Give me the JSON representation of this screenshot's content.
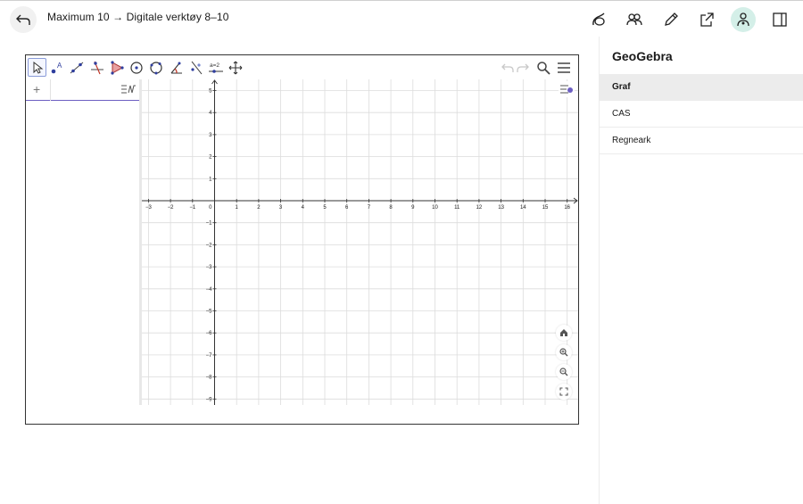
{
  "header": {
    "breadcrumb": "Maximum 10 → Digitale verktøy 8–10",
    "icons": [
      "back-arrow-icon",
      "geogebra-icon",
      "people-icon",
      "pencil-icon",
      "share-icon",
      "user-settings-icon",
      "sidebar-toggle-icon"
    ],
    "active_color": "#d4efe8"
  },
  "panel": {
    "title": "GeoGebra",
    "items": [
      {
        "label": "Graf",
        "active": true
      },
      {
        "label": "CAS",
        "active": false
      },
      {
        "label": "Regneark",
        "active": false
      }
    ]
  },
  "app": {
    "tools": [
      "move-tool-icon",
      "point-tool-icon",
      "line-tool-icon",
      "perpendicular-line-tool-icon",
      "polygon-tool-icon",
      "circle-center-tool-icon",
      "circle-three-points-tool-icon",
      "angle-tool-icon",
      "reflect-tool-icon",
      "slider-tool-icon",
      "move-graphics-view-tool-icon"
    ],
    "slider_tool_label": "a=2",
    "algebra_plus": "+",
    "graph": {
      "x_min": -3,
      "x_max": 16,
      "y_min": -9,
      "y_max": 5,
      "x_ticks": [
        "−3",
        "−2",
        "−1",
        "0",
        "1",
        "2",
        "3",
        "4",
        "5",
        "6",
        "7",
        "8",
        "9",
        "10",
        "11",
        "12",
        "13",
        "14",
        "15",
        "16"
      ],
      "y_ticks": [
        "5",
        "4",
        "3",
        "2",
        "1",
        "−1",
        "−2",
        "−3",
        "−4",
        "−5",
        "−6",
        "−7",
        "−8",
        "−9"
      ],
      "grid": true
    }
  }
}
